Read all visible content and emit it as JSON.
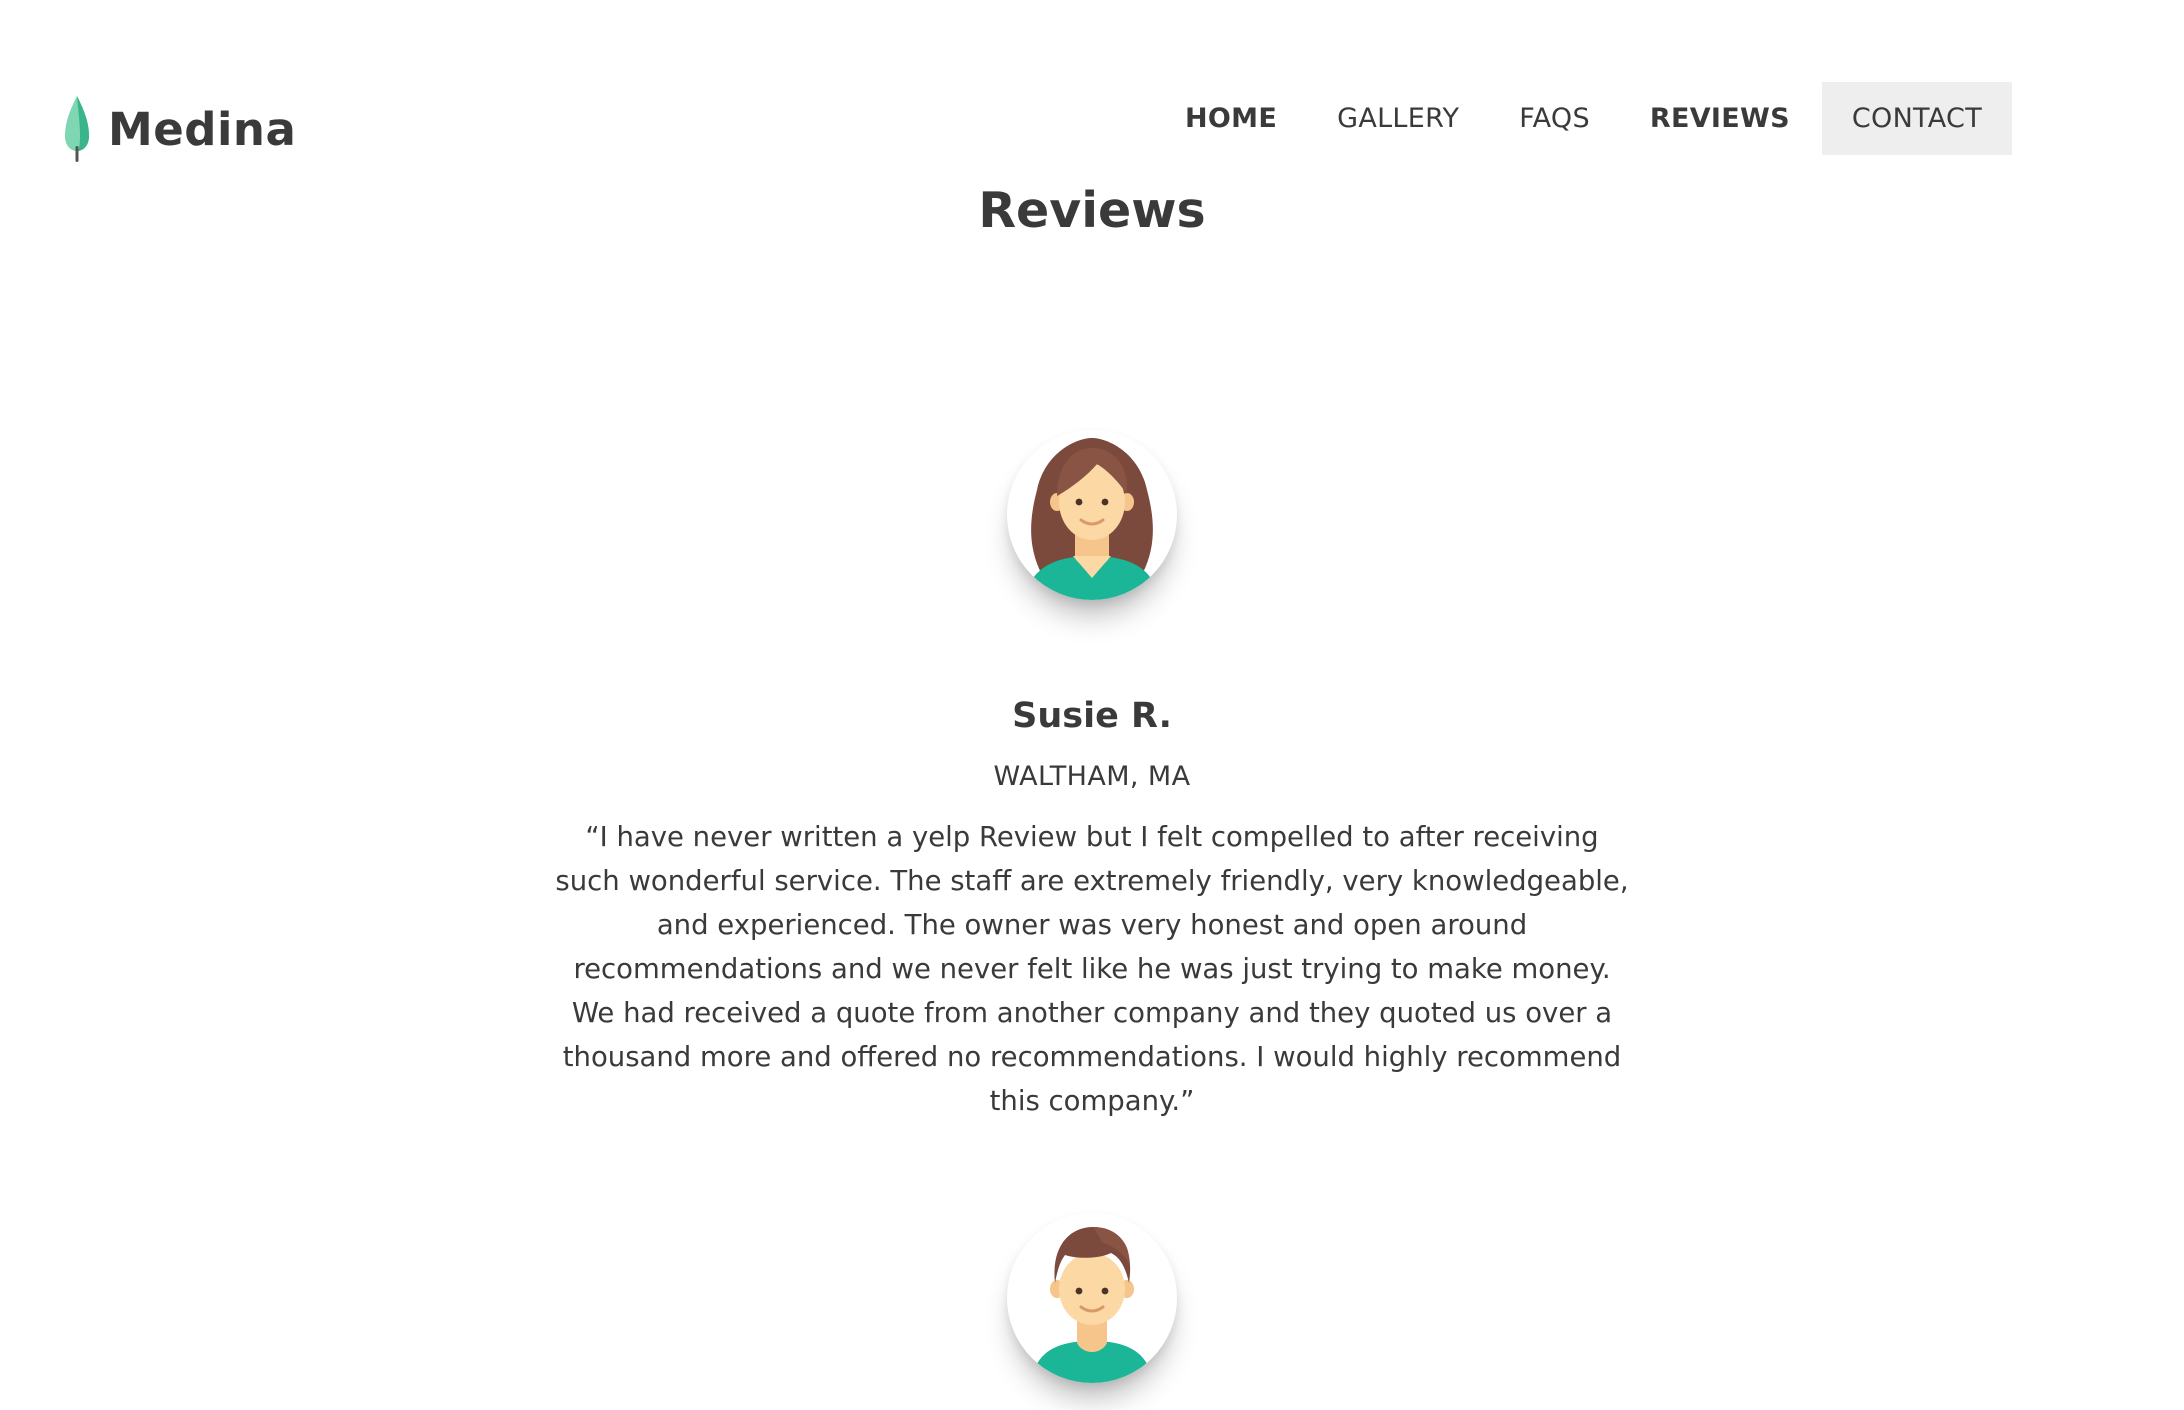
{
  "header": {
    "brand": {
      "name": "Medina",
      "icon": "tree-icon",
      "icon_colors": [
        "#7fd6b3",
        "#3ab48a",
        "#555555"
      ]
    },
    "nav": [
      {
        "label": "HOME",
        "bold": true,
        "highlighted": false
      },
      {
        "label": "GALLERY",
        "bold": false,
        "highlighted": false
      },
      {
        "label": "FAQS",
        "bold": false,
        "highlighted": false
      },
      {
        "label": "REVIEWS",
        "bold": true,
        "highlighted": false
      },
      {
        "label": "CONTACT",
        "bold": false,
        "highlighted": true
      }
    ]
  },
  "page": {
    "title": "Reviews"
  },
  "reviews": [
    {
      "avatar": "woman-avatar-icon",
      "name": "Susie R.",
      "location": "WALTHAM, MA",
      "text": "“I have never written a yelp Review but I felt compelled to after receiving such wonderful service. The staff are extremely friendly, very knowledgeable, and experienced. The owner was very honest and open around recommendations and we never felt like he was just trying to make money. We had received a quote from another company and they quoted us over a thousand more and offered no recommendations. I would highly recommend this company.”"
    },
    {
      "avatar": "man-avatar-icon"
    }
  ],
  "colors": {
    "text": "#3a3a3a",
    "nav_highlight_bg": "#eeeeee",
    "avatar_shirt": "#1bb597",
    "avatar_hair": "#7b4a3c",
    "avatar_skin": "#fcd8a4"
  }
}
